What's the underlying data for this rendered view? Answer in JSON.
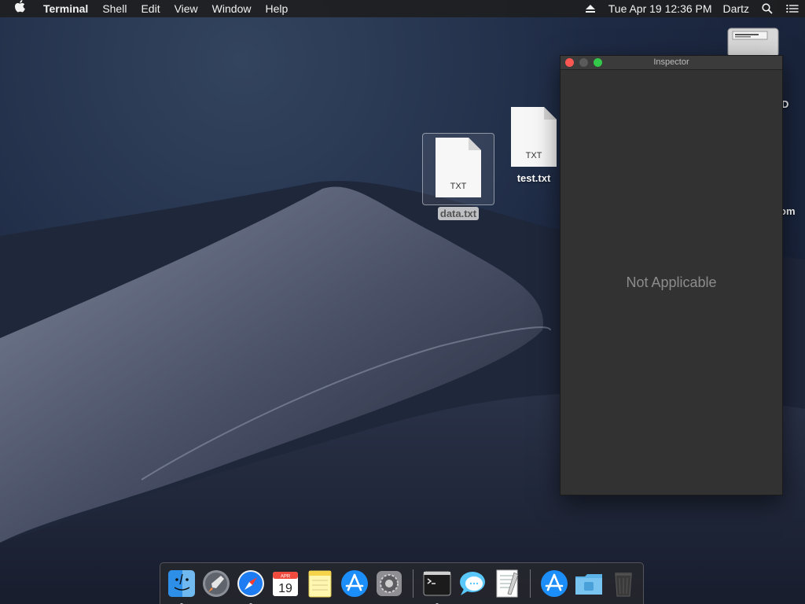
{
  "menubar": {
    "app_name": "Terminal",
    "menus": [
      "Shell",
      "Edit",
      "View",
      "Window",
      "Help"
    ],
    "clock": "Tue Apr 19  12:36 PM",
    "user": "Dartz"
  },
  "desktop": {
    "files": [
      {
        "name": "data.txt",
        "ext": "TXT",
        "selected": true
      },
      {
        "name": "test.txt",
        "ext": "TXT",
        "selected": false
      }
    ],
    "edge_labels": [
      "D",
      "om"
    ]
  },
  "inspector": {
    "title": "Inspector",
    "message": "Not Applicable"
  },
  "dock": {
    "calendar_month": "APR",
    "calendar_day": "19",
    "items": [
      "finder-icon",
      "launchpad-icon",
      "safari-icon",
      "calendar-icon",
      "notes-icon",
      "app-store-icon",
      "system-preferences-icon",
      "terminal-icon",
      "messages-icon",
      "textedit-icon",
      "app-store-folder-icon",
      "downloads-folder-icon",
      "trash-icon"
    ]
  },
  "colors": {
    "close": "#fc5753",
    "minimize": "#5a5a5a",
    "zoom": "#34c84a",
    "accent": "#1e7cf2"
  }
}
